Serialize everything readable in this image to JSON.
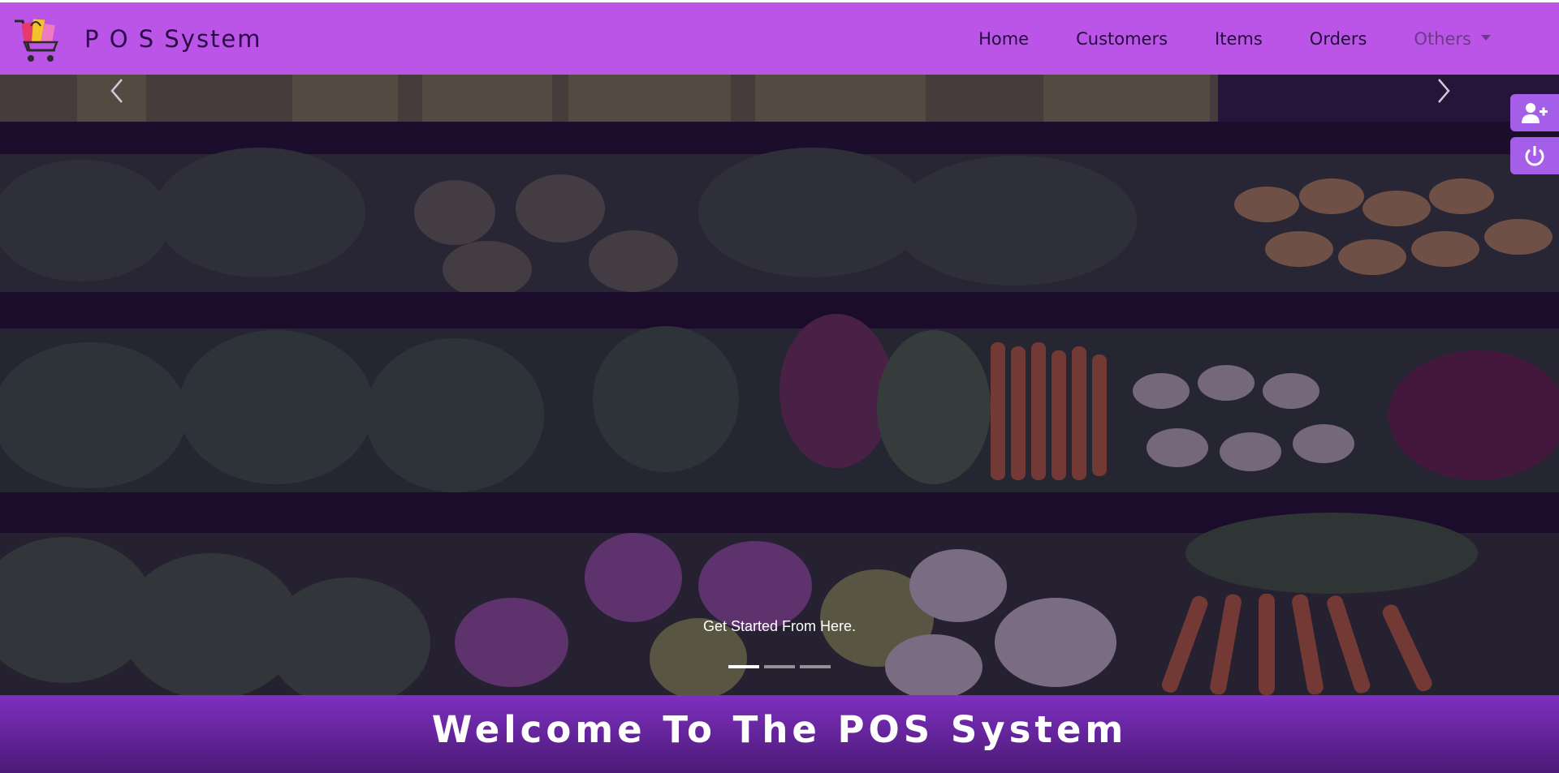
{
  "brand": {
    "title": "P O S System",
    "logo_icon": "shopping-cart-logo"
  },
  "nav": {
    "items": [
      {
        "label": "Home"
      },
      {
        "label": "Customers"
      },
      {
        "label": "Items"
      },
      {
        "label": "Orders"
      }
    ],
    "dropdown": {
      "label": "Others"
    }
  },
  "side_actions": [
    {
      "icon": "add-user-icon"
    },
    {
      "icon": "power-icon"
    }
  ],
  "carousel": {
    "caption": "Get Started From Here.",
    "slide_count": 3,
    "active_index": 0,
    "prev_icon": "chevron-left-icon",
    "next_icon": "chevron-right-icon"
  },
  "welcome": {
    "text": "Welcome To The POS System"
  },
  "colors": {
    "navbar": "#bb55e8",
    "side_button": "#a55ee8",
    "welcome_top": "#7e2fc0",
    "welcome_bottom": "#4b1a75"
  }
}
